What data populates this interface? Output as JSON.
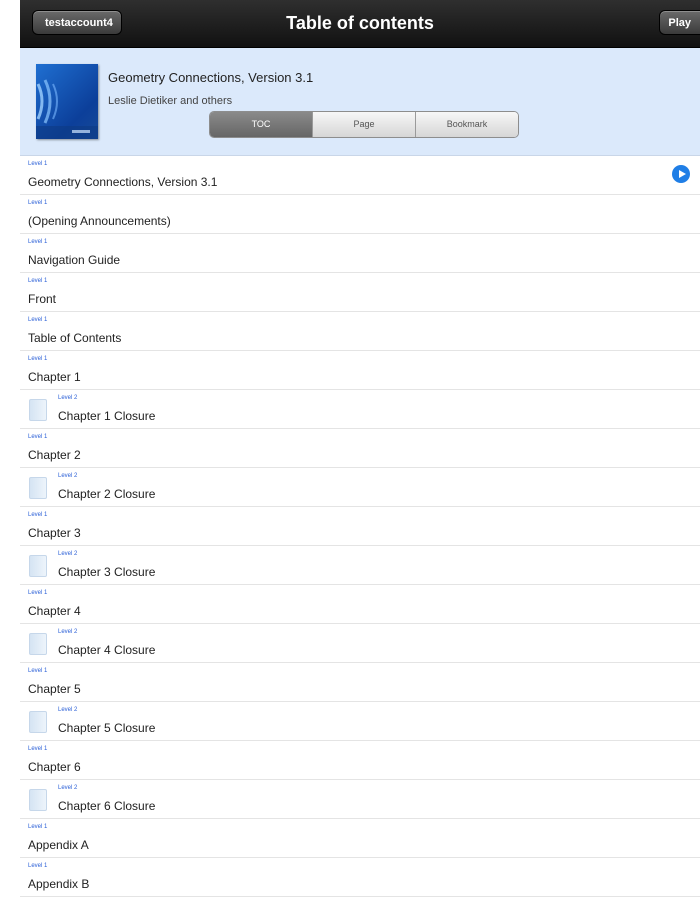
{
  "navbar": {
    "back_label": "testaccount4",
    "title": "Table of contents",
    "play_label": "Play"
  },
  "book": {
    "title": "Geometry Connections, Version 3.1",
    "author": "Leslie Dietiker and others"
  },
  "tabs": [
    {
      "label": "TOC",
      "active": true
    },
    {
      "label": "Page",
      "active": false
    },
    {
      "label": "Bookmark",
      "active": false
    }
  ],
  "toc": [
    {
      "level": "Level 1",
      "text": "Geometry Connections, Version 3.1",
      "depth": 1,
      "play": true
    },
    {
      "level": "Level 1",
      "text": "(Opening Announcements)",
      "depth": 1
    },
    {
      "level": "Level 1",
      "text": "Navigation Guide",
      "depth": 1
    },
    {
      "level": "Level 1",
      "text": "Front",
      "depth": 1
    },
    {
      "level": "Level 1",
      "text": "Table of Contents",
      "depth": 1
    },
    {
      "level": "Level 1",
      "text": "Chapter 1",
      "depth": 1
    },
    {
      "level": "Level 2",
      "text": "Chapter 1 Closure",
      "depth": 2
    },
    {
      "level": "Level 1",
      "text": "Chapter 2",
      "depth": 1
    },
    {
      "level": "Level 2",
      "text": "Chapter 2 Closure",
      "depth": 2
    },
    {
      "level": "Level 1",
      "text": "Chapter 3",
      "depth": 1
    },
    {
      "level": "Level 2",
      "text": "Chapter 3 Closure",
      "depth": 2
    },
    {
      "level": "Level 1",
      "text": "Chapter 4",
      "depth": 1
    },
    {
      "level": "Level 2",
      "text": "Chapter 4 Closure",
      "depth": 2
    },
    {
      "level": "Level 1",
      "text": "Chapter 5",
      "depth": 1
    },
    {
      "level": "Level 2",
      "text": "Chapter 5 Closure",
      "depth": 2
    },
    {
      "level": "Level 1",
      "text": "Chapter 6",
      "depth": 1
    },
    {
      "level": "Level 2",
      "text": "Chapter 6 Closure",
      "depth": 2
    },
    {
      "level": "Level 1",
      "text": "Appendix A",
      "depth": 1
    },
    {
      "level": "Level 1",
      "text": "Appendix B",
      "depth": 1
    }
  ]
}
